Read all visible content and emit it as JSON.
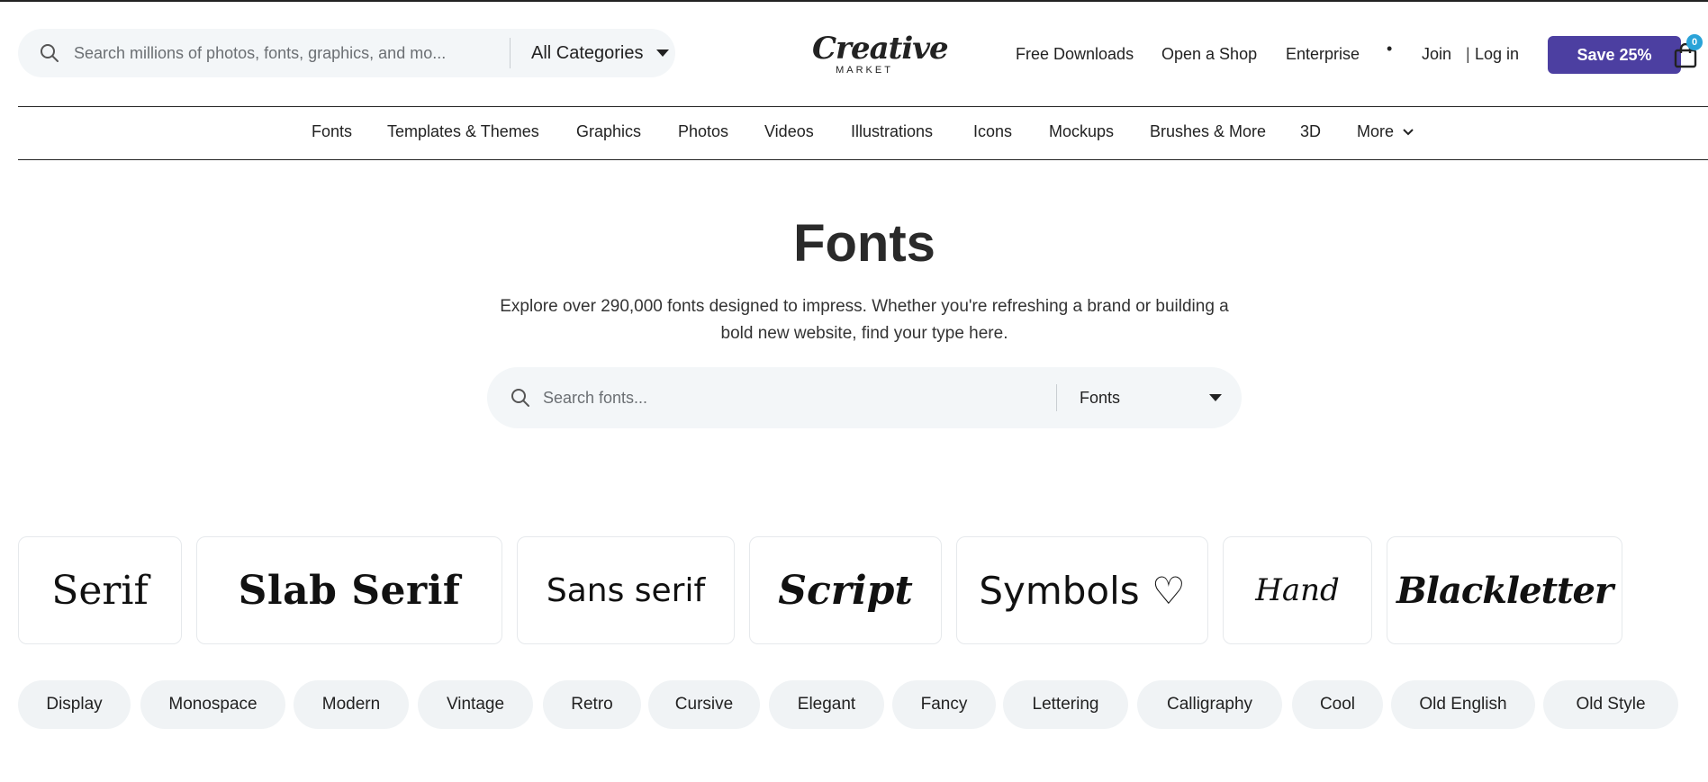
{
  "header": {
    "search": {
      "placeholder": "Search millions of photos, fonts, graphics, and mo..."
    },
    "category_select": {
      "selected": "All Categories"
    },
    "logo": {
      "main": "Creative",
      "sub": "MARKET"
    },
    "links": {
      "free_downloads": "Free Downloads",
      "open_shop": "Open a Shop",
      "enterprise": "Enterprise",
      "dot": "•",
      "join": "Join",
      "separator": "|",
      "login": "Log in"
    },
    "save_label": "Save 25%",
    "cart_count": "0"
  },
  "category_nav": {
    "items": [
      "Fonts",
      "Templates & Themes",
      "Graphics",
      "Photos",
      "Videos",
      "Illustrations",
      "Icons",
      "Mockups",
      "Brushes & More",
      "3D"
    ],
    "more_label": "More"
  },
  "hero": {
    "title": "Fonts",
    "description": "Explore over 290,000 fonts designed to impress. Whether you're refreshing a brand or building a bold new website, find your type here.",
    "search_placeholder": "Search fonts...",
    "type_select": "Fonts"
  },
  "font_styles": [
    "Serif",
    "Slab Serif",
    "Sans serif",
    "Script",
    "Symbols ♡",
    "Hand",
    "Blackletter"
  ],
  "tags": [
    "Display",
    "Monospace",
    "Modern",
    "Vintage",
    "Retro",
    "Cursive",
    "Elegant",
    "Fancy",
    "Lettering",
    "Calligraphy",
    "Cool",
    "Old English",
    "Old Style"
  ],
  "colors": {
    "accent_button": "#4c3fa1",
    "cart_badge": "#2aa3d8",
    "search_bg": "#f3f6f8",
    "chip_bg": "#f0f3f5"
  },
  "icons": {
    "search": "search-icon",
    "caret": "chevron-down-icon",
    "cart": "shopping-bag-icon"
  }
}
